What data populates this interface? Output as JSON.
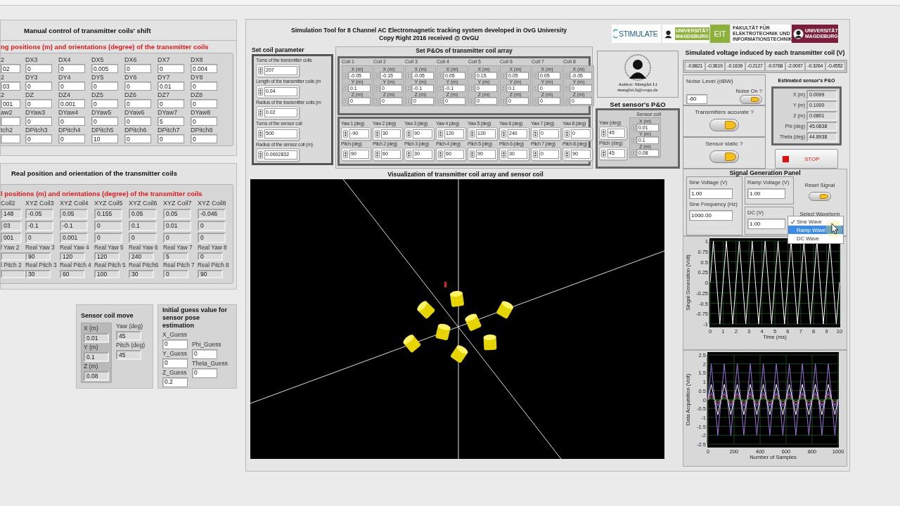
{
  "manual_panel": {
    "title": "Manual control of transmitter coils' shift",
    "subtitle": "ng positions (m) and orientations (degree) of the transmitter coils",
    "rows": [
      [
        {
          "label": "2",
          "value": "02"
        },
        {
          "label": "DX3",
          "value": "0"
        },
        {
          "label": "DX4",
          "value": "0"
        },
        {
          "label": "DX5",
          "value": "0.005"
        },
        {
          "label": "DX6",
          "value": "0"
        },
        {
          "label": "DX7",
          "value": "0"
        },
        {
          "label": "DX8",
          "value": "0.004"
        }
      ],
      [
        {
          "label": "2",
          "value": "03"
        },
        {
          "label": "DY3",
          "value": "0"
        },
        {
          "label": "DY4",
          "value": "0"
        },
        {
          "label": "DY5",
          "value": "0"
        },
        {
          "label": "DY6",
          "value": "0"
        },
        {
          "label": "DY7",
          "value": "0.01"
        },
        {
          "label": "DY8",
          "value": "0"
        }
      ],
      [
        {
          "label": "2",
          "value": "001"
        },
        {
          "label": "DZ",
          "value": "0"
        },
        {
          "label": "DZ4",
          "value": "0.001"
        },
        {
          "label": "DZ5",
          "value": "0"
        },
        {
          "label": "DZ6",
          "value": "0"
        },
        {
          "label": "DZ7",
          "value": "0"
        },
        {
          "label": "DZ8",
          "value": "0"
        }
      ],
      [
        {
          "label": "aw2"
        },
        {
          "label": "DYaw3",
          "value": "0"
        },
        {
          "label": "DYaw4",
          "value": "0"
        },
        {
          "label": "DYaw5",
          "value": "0"
        },
        {
          "label": "DYaw6",
          "value": "0"
        },
        {
          "label": "DYaw7",
          "value": "5"
        },
        {
          "label": "DYaw8",
          "value": "0"
        }
      ],
      [
        {
          "label": "tch2"
        },
        {
          "label": "DPitch3",
          "value": "0"
        },
        {
          "label": "DPitch4",
          "value": "0"
        },
        {
          "label": "DPitch5",
          "value": "10"
        },
        {
          "label": "DPitch6",
          "value": "0"
        },
        {
          "label": "DPitch7",
          "value": "0"
        },
        {
          "label": "DPitch8",
          "value": "0"
        }
      ]
    ]
  },
  "real_panel": {
    "title": "Real position and orientation of the transmitter coils",
    "subtitle": "l positions (m) and orientations (degree) of the transmitter coils",
    "columns": [
      {
        "header": "Coil2",
        "xyz": [
          "148",
          "03",
          "001"
        ],
        "yaw_label": "l Yaw 2",
        "pitch_label": "l Pitch 2"
      },
      {
        "header": "XYZ Coil3",
        "xyz": [
          "-0.05",
          "-0.1",
          "0"
        ],
        "yaw_label": "Real Yaw 3",
        "yaw": "90",
        "pitch_label": "Real Pitch 3",
        "pitch": "30"
      },
      {
        "header": "XYZ Coil4",
        "xyz": [
          "0.05",
          "-0.1",
          "0.001"
        ],
        "yaw_label": "Real Yaw 4",
        "yaw": "120",
        "pitch_label": "Real Pitch 4",
        "pitch": "60"
      },
      {
        "header": "XYZ Coil5",
        "xyz": [
          "0.155",
          "0",
          "0"
        ],
        "yaw_label": "Real Yaw 5",
        "yaw": "120",
        "pitch_label": "Real Pitch 5",
        "pitch": "100"
      },
      {
        "header": "XYZ Coil6",
        "xyz": [
          "0.05",
          "0.1",
          "0"
        ],
        "yaw_label": "Real Yaw 6",
        "yaw": "240",
        "pitch_label": "Real Pitch6",
        "pitch": "30"
      },
      {
        "header": "XYZ Coil7",
        "xyz": [
          "0.05",
          "0.01",
          "0"
        ],
        "yaw_label": "Real Yaw 7",
        "yaw": "5",
        "pitch_label": "Real Pitch 7",
        "pitch": "0"
      },
      {
        "header": "XYZ Coil8",
        "xyz": [
          "-0.046",
          "0",
          "0"
        ],
        "yaw_label": "Real Yaw 8",
        "yaw": "0",
        "pitch_label": "Real Pitch 8",
        "pitch": "90"
      }
    ]
  },
  "sensor_move": {
    "title": "Sensor coil move",
    "position": [
      {
        "label": "X (m)",
        "value": "0.01"
      },
      {
        "label": "Y (m)",
        "value": "0.1"
      },
      {
        "label": "Z (m)",
        "value": "0.08"
      }
    ],
    "orientation": [
      {
        "label": "Yaw (deg)",
        "value": "45"
      },
      {
        "label": "Pitch (deg)",
        "value": "45"
      }
    ]
  },
  "initial_guess": {
    "title": "Initial guess value for sensor pose estimation",
    "left": [
      {
        "label": "X_Guess",
        "value": "0"
      },
      {
        "label": "Y_Guess",
        "value": "0"
      },
      {
        "label": "Z_Guess",
        "value": "0.2"
      }
    ],
    "right": [
      {
        "label": "Phi_Guess",
        "value": "0"
      },
      {
        "label": "Theta_Guess",
        "value": "0"
      }
    ]
  },
  "main": {
    "title_lines": [
      "Simulation Tool for 8 Channel AC Electromagnetic tracking system developed in OvG University",
      "Copy Right 2016 received @ OvGU"
    ],
    "logos": {
      "stimulate": "STIMULATE",
      "university": "UNIVERSITÄT MAGDEBURG",
      "eit": "EIT",
      "faculty": "FAKULTÄT FÜR ELEKTROTECHNIK UND INFORMATIONSTECHNIK",
      "university_2": "UNIVERSITÄT MAGDEBURG"
    },
    "coil_parameters": {
      "title": "Set coil parameter",
      "items": [
        {
          "label": "Turns of the transmitter coils",
          "value": "207"
        },
        {
          "label": "Length of the transmitter coils (m",
          "value": "0.04"
        },
        {
          "label": "Radius of the transmitter coils (m",
          "value": "0.02"
        },
        {
          "label": "Turns of the sensor coil",
          "value": "500"
        },
        {
          "label": "Radius of the sensor coil (m)",
          "value": "0.0002832"
        }
      ]
    },
    "coil_array": {
      "title": "Set P&Os of transmitter coil array",
      "coils": [
        {
          "label": "Coil 1",
          "fields": [
            {
              "label": "X (m)",
              "value": "-0.05"
            },
            {
              "label": "Y (m)",
              "value": "0.1"
            },
            {
              "label": "Z (m)",
              "value": "0"
            }
          ]
        },
        {
          "label": "Coil 2",
          "fields": [
            {
              "label": "X (m)",
              "value": "-0.15"
            },
            {
              "label": "Y (m)",
              "value": "0"
            },
            {
              "label": "Z (m)",
              "value": "0"
            }
          ]
        },
        {
          "label": "Coil 3",
          "fields": [
            {
              "label": "X (m)",
              "value": "-0.05"
            },
            {
              "label": "Y (m)",
              "value": "-0.1"
            },
            {
              "label": "Z (m)",
              "value": "0"
            }
          ]
        },
        {
          "label": "Coil 4",
          "fields": [
            {
              "label": "X (m)",
              "value": "0.05"
            },
            {
              "label": "Y (m)",
              "value": "-0.1"
            },
            {
              "label": "Z (m)",
              "value": "0"
            }
          ]
        },
        {
          "label": "Coil 5",
          "fields": [
            {
              "label": "X (m)",
              "value": "0.15"
            },
            {
              "label": "Y (m)",
              "value": "0"
            },
            {
              "label": "Z (m)",
              "value": "0"
            }
          ]
        },
        {
          "label": "Coil 6",
          "fields": [
            {
              "label": "X (m)",
              "value": "0.05"
            },
            {
              "label": "Y (m)",
              "value": "0.1"
            },
            {
              "label": "Z (m)",
              "value": "0"
            }
          ]
        },
        {
          "label": "Coil 7",
          "fields": [
            {
              "label": "X (m)",
              "value": "0.05"
            },
            {
              "label": "Y (m)",
              "value": "0"
            },
            {
              "label": "Z (m)",
              "value": "0"
            }
          ]
        },
        {
          "label": "Coil 8",
          "fields": [
            {
              "label": "X (m)",
              "value": "-0.05"
            },
            {
              "label": "Y (m)",
              "value": "0"
            },
            {
              "label": "Z (m)",
              "value": "0"
            }
          ]
        }
      ],
      "angles": [
        {
          "yaw_label": "Yaw 1 (deg)",
          "yaw": "-90",
          "pitch_label": "Pitch (deg)",
          "pitch": "90"
        },
        {
          "yaw_label": "Yaw 2 (deg)",
          "yaw": "30",
          "pitch_label": "Pitch 2 (deg)",
          "pitch": "60"
        },
        {
          "yaw_label": "Yaw 3 (deg)",
          "yaw": "90",
          "pitch_label": "Pitch 3 (deg)",
          "pitch": "30"
        },
        {
          "yaw_label": "Yaw 4 (deg)",
          "yaw": "120",
          "pitch_label": "Pitch 4 (deg)",
          "pitch": "60"
        },
        {
          "yaw_label": "Yaw 5 (deg)",
          "yaw": "120",
          "pitch_label": "Pitch 5 (deg)",
          "pitch": "90"
        },
        {
          "yaw_label": "Yaw 6 (deg)",
          "yaw": "240",
          "pitch_label": "Pitch 6 (deg)",
          "pitch": "30"
        },
        {
          "yaw_label": "Yaw 7 (deg)",
          "yaw": "0",
          "pitch_label": "Pitch 7 (deg)",
          "pitch": "0"
        },
        {
          "yaw_label": "Yaw 8 (deg)",
          "yaw": "0",
          "pitch_label": "Pitch 8 (deg)",
          "pitch": "90"
        }
      ]
    },
    "author": {
      "name": "Author: Mengfei Li",
      "email": "mengfei.li@ovgu.de"
    },
    "sensor_set": {
      "title": "Set sensor's P&O",
      "yaw": {
        "label": "Yaw (deg)",
        "value": "45"
      },
      "pitch": {
        "label": "Pitch (deg)",
        "value": "45"
      },
      "coil_title": "Sensor coil",
      "fields": [
        {
          "label": "X (m)",
          "value": "0.01"
        },
        {
          "label": "Y (m)",
          "value": "0.1"
        },
        {
          "label": "Z (m)",
          "value": "0.08"
        }
      ]
    },
    "voltages": {
      "title": "Simulated voltage induced by each transmitter coil (V)",
      "values": [
        "-0.8821",
        "-0.3619",
        "-0.1639",
        "-0.2127",
        "-0.0768",
        "-2.0097",
        "-0.3264",
        "-0.4552"
      ]
    },
    "noise": {
      "title": "Noise Level (dBW)",
      "value": "-60",
      "toggle_label": "Noise On ?",
      "on": true
    },
    "switches": [
      {
        "label": "Transmitters accurate ?",
        "on": true
      },
      {
        "label": "Sensor static ?",
        "on": true
      }
    ],
    "estimate": {
      "title": "Estimated sensor's P&O",
      "fields": [
        {
          "label": "X (m)",
          "value": "0.0099"
        },
        {
          "label": "Y (m)",
          "value": "0.1000"
        },
        {
          "label": "Z (m)",
          "value": "0.0801"
        },
        {
          "label": "Phi (deg)",
          "value": "45.0838"
        },
        {
          "label": "Theta (deg)",
          "value": "44.8938"
        }
      ]
    },
    "stop_button": "STOP",
    "visualization_title": "Visualization of transmitter coil array and sensor coil",
    "signal": {
      "title": "Signal Generation Panel",
      "sine_voltage": {
        "label": "Sine Voltage (V)",
        "value": "1.00"
      },
      "ramp_voltage": {
        "label": "Ramp Voltage (V)",
        "value": "1.00"
      },
      "sine_frequency": {
        "label": "Sine Frequency (Hz)",
        "value": "1000.00"
      },
      "dc": {
        "label": "DC  (V)",
        "value": "1.00"
      },
      "reset": {
        "label": "Reset Signal",
        "on": true
      },
      "waveform": {
        "label": "Select Waveform",
        "options": [
          {
            "label": "Sine Wave",
            "checked": true,
            "selected": false
          },
          {
            "label": "Ramp Wave",
            "checked": false,
            "selected": true
          },
          {
            "label": "DC Wave",
            "checked": false,
            "selected": false
          }
        ]
      }
    },
    "charts": [
      {
        "chart_data": {
          "type": "line",
          "grid": true,
          "xlabel": "Time (ms)",
          "ylabel": "Singal Generation  (Volt)",
          "xlim": [
            0,
            10
          ],
          "ylim": [
            -1,
            1
          ],
          "xticks": [
            0,
            1,
            2,
            3,
            4,
            5,
            6,
            7,
            8,
            9,
            10
          ],
          "yticks": [
            -1,
            -0.75,
            -0.5,
            -0.25,
            0,
            0.25,
            0.5,
            0.75,
            1
          ],
          "x": [
            0,
            0.25,
            0.5,
            0.75,
            1,
            1.25,
            1.5,
            1.75,
            2,
            2.25,
            2.5,
            2.75,
            3,
            3.25,
            3.5,
            3.75,
            4,
            4.25,
            4.5,
            4.75,
            5,
            5.25,
            5.5,
            5.75,
            6,
            6.25,
            6.5,
            6.75,
            7,
            7.25,
            7.5,
            7.75,
            8,
            8.25,
            8.5,
            8.75,
            9,
            9.25,
            9.5,
            9.75,
            10
          ],
          "series": [
            {
              "color": "#ffffff",
              "values": [
                0,
                1,
                0,
                -1,
                0,
                1,
                0,
                -1,
                0,
                1,
                0,
                -1,
                0,
                1,
                0,
                -1,
                0,
                1,
                0,
                -1,
                0,
                1,
                0,
                -1,
                0,
                1,
                0,
                -1,
                0,
                1,
                0,
                -1,
                0,
                1,
                0,
                -1,
                0,
                1,
                0,
                -1,
                0
              ]
            }
          ]
        }
      },
      {
        "chart_data": {
          "type": "line",
          "grid": true,
          "xlabel": "Number of Samples",
          "ylabel": "Data Acquisition (Volt)",
          "xlim": [
            0,
            1000
          ],
          "ylim": [
            -2.5,
            2.5
          ],
          "xticks": [
            0,
            200,
            400,
            600,
            800,
            1000
          ],
          "yticks": [
            -2.5,
            -2,
            -1.5,
            -1,
            -0.5,
            0,
            0.5,
            1,
            1.5,
            2,
            2.5
          ],
          "x": [
            0,
            25,
            50,
            75,
            100,
            125,
            150,
            175,
            200,
            225,
            250,
            275,
            300,
            325,
            350,
            375,
            400,
            425,
            450,
            475,
            500,
            525,
            550,
            575,
            600,
            625,
            650,
            675,
            700,
            725,
            750,
            775,
            800,
            825,
            850,
            875,
            900,
            925,
            950,
            975,
            1000
          ],
          "series": [
            {
              "color": "#a070e0",
              "values": [
                0,
                2,
                0,
                -2,
                0,
                2,
                0,
                -2,
                0,
                2,
                0,
                -2,
                0,
                2,
                0,
                -2,
                0,
                2,
                0,
                -2,
                0,
                2,
                0,
                -2,
                0,
                2,
                0,
                -2,
                0,
                2,
                0,
                -2,
                0,
                2,
                0,
                -2,
                0,
                2,
                0,
                -2,
                0
              ]
            },
            {
              "color": "#ffffff",
              "values": [
                0,
                0.85,
                0,
                -0.85,
                0,
                0.85,
                0,
                -0.85,
                0,
                0.85,
                0,
                -0.85,
                0,
                0.85,
                0,
                -0.85,
                0,
                0.85,
                0,
                -0.85,
                0,
                0.85,
                0,
                -0.85,
                0,
                0.85,
                0,
                -0.85,
                0,
                0.85,
                0,
                -0.85,
                0,
                0.85,
                0,
                -0.85,
                0,
                0.85,
                0,
                -0.85,
                0
              ]
            },
            {
              "color": "#4a5cff",
              "values": [
                0,
                0.4,
                0,
                -0.4,
                0,
                0.4,
                0,
                -0.4,
                0,
                0.4,
                0,
                -0.4,
                0,
                0.4,
                0,
                -0.4,
                0,
                0.4,
                0,
                -0.4,
                0,
                0.4,
                0,
                -0.4,
                0,
                0.4,
                0,
                -0.4,
                0,
                0.4,
                0,
                -0.4,
                0,
                0.4,
                0,
                -0.4,
                0,
                0.4,
                0,
                -0.4,
                0
              ]
            },
            {
              "color": "#ff4d6a",
              "values": [
                0,
                0.3,
                0,
                -0.3,
                0,
                0.3,
                0,
                -0.3,
                0,
                0.3,
                0,
                -0.3,
                0,
                0.3,
                0,
                -0.3,
                0,
                0.3,
                0,
                -0.3,
                0,
                0.3,
                0,
                -0.3,
                0,
                0.3,
                0,
                -0.3,
                0,
                0.3,
                0,
                -0.3,
                0,
                0.3,
                0,
                -0.3,
                0,
                0.3,
                0,
                -0.3,
                0
              ]
            },
            {
              "color": "#50e050",
              "values": [
                0,
                0.12,
                0,
                -0.12,
                0,
                0.12,
                0,
                -0.12,
                0,
                0.12,
                0,
                -0.12,
                0,
                0.12,
                0,
                -0.12,
                0,
                0.12,
                0,
                -0.12,
                0,
                0.12,
                0,
                -0.12,
                0,
                0.12,
                0,
                -0.12,
                0,
                0.12,
                0,
                -0.12,
                0,
                0.12,
                0,
                -0.12,
                0,
                0.12,
                0,
                -0.12,
                0
              ]
            }
          ]
        }
      }
    ]
  }
}
